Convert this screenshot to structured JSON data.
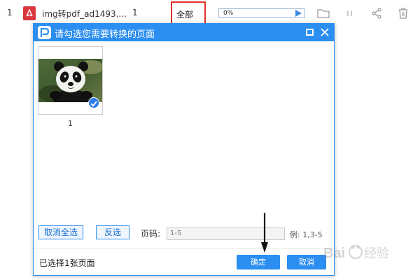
{
  "file_row": {
    "index": "1",
    "file_name": "img转pdf_ad1493....",
    "page_count": "1",
    "page_range": "全部",
    "progress_text": "0%",
    "progress_value": 0
  },
  "dialog": {
    "title": "请勾选您需要转换的页面",
    "thumbnails": [
      {
        "label": "1",
        "checked": true
      }
    ],
    "deselect_all_label": "取消全选",
    "invert_label": "反选",
    "page_label": "页码:",
    "page_input_value": "1-5",
    "example_text": "例: 1,3-5",
    "selected_count_text": "已选择1张页面",
    "confirm_label": "确定",
    "cancel_label": "取消"
  },
  "watermark": {
    "text": "Bai 经验"
  },
  "colors": {
    "accent": "#2b8ef0",
    "pdf_red": "#d9363e",
    "highlight_red": "#e0302b"
  }
}
